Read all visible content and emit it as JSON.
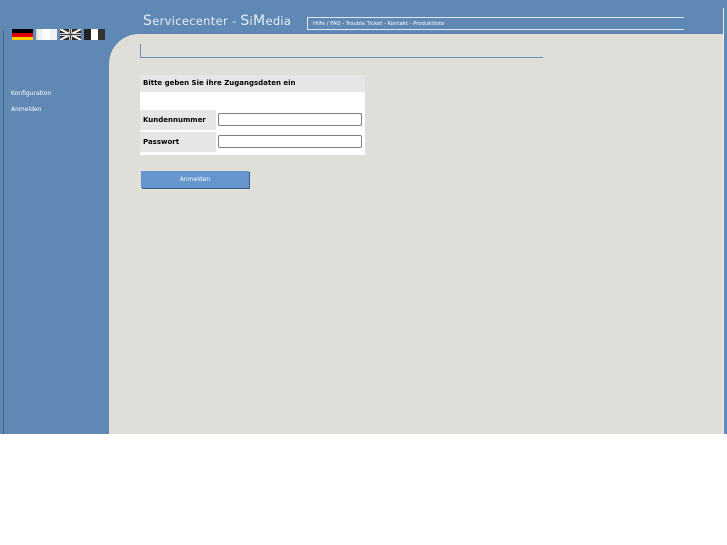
{
  "header": {
    "title_prefix_cap": "S",
    "title_prefix": "ervicecenter - ",
    "title_brand_s": "S",
    "title_brand_i": "i",
    "title_brand_m": "M",
    "title_brand_rest": "edia",
    "nav_links": "Hilfe / FAQ - Trouble Ticket - Kontakt - Produktliste"
  },
  "flags": [
    "flag-de-icon",
    "flag-fr-icon",
    "flag-uk-icon",
    "flag-it-icon"
  ],
  "sidebar": {
    "items": [
      {
        "label": "Konfiguration"
      },
      {
        "label": "Anmelden"
      }
    ]
  },
  "login": {
    "heading": "Bitte geben Sie ihre Zugangsdaten ein",
    "customer_label": "Kundennummer",
    "customer_value": "",
    "password_label": "Passwort",
    "password_value": "",
    "submit_label": "Anmelden"
  },
  "colors": {
    "frame": "#5f88b5",
    "content": "#dfded8",
    "button": "#6595cc"
  }
}
